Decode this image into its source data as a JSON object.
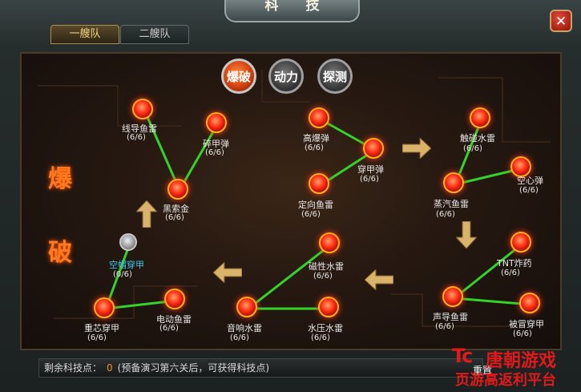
{
  "title": "科 技",
  "close_label": "✕",
  "tabs": [
    {
      "label": "一艘队",
      "active": true
    },
    {
      "label": "二艘队",
      "active": false
    }
  ],
  "categories": [
    {
      "label": "爆破",
      "active": true
    },
    {
      "label": "动力",
      "active": false
    },
    {
      "label": "探测",
      "active": false
    }
  ],
  "side_title": [
    "爆",
    "破"
  ],
  "nodes": {
    "wire_mine": {
      "name": "线导鱼雷",
      "level": "(6/6)"
    },
    "ap_bomb": {
      "name": "碎甲弹",
      "level": "(6/6)"
    },
    "black_cable": {
      "name": "黑索金",
      "level": "(6/6)"
    },
    "hollow_ap": {
      "name": "空帽穿甲",
      "level": "(0/6)"
    },
    "core_ap": {
      "name": "重芯穿甲",
      "level": "(6/6)"
    },
    "electric_torpedo": {
      "name": "电动鱼雷",
      "level": "(6/6)"
    },
    "he_bomb": {
      "name": "高爆弹",
      "level": "(6/6)"
    },
    "pierce_bomb": {
      "name": "穿甲弹",
      "level": "(6/6)"
    },
    "directional_torpedo": {
      "name": "定向鱼雷",
      "level": "(6/6)"
    },
    "magnetic_mine": {
      "name": "磁性水雷",
      "level": "(6/6)"
    },
    "acoustic_mine": {
      "name": "音响水雷",
      "level": "(6/6)"
    },
    "pressure_mine": {
      "name": "水压水雷",
      "level": "(6/6)"
    },
    "contact_mine": {
      "name": "触碰水雷",
      "level": "(6/6)"
    },
    "hollow_bomb": {
      "name": "空心弹",
      "level": "(6/6)"
    },
    "steam_torpedo": {
      "name": "蒸汽鱼雷",
      "level": "(6/6)"
    },
    "tnt": {
      "name": "TNT炸药",
      "level": "(6/6)"
    },
    "sonar_torpedo": {
      "name": "声导鱼雷",
      "level": "(6/6)"
    },
    "capped_ap": {
      "name": "被冒穿甲",
      "level": "(6/6)"
    }
  },
  "status": {
    "points_label": "剩余科技点：",
    "points_value": "0",
    "hint": "(预备演习第六关后，可获得科技点)"
  },
  "reset_label": "重置",
  "watermark": {
    "logo": "Tc",
    "line1": "唐朝游戏",
    "line2": "页游高返利平台"
  }
}
